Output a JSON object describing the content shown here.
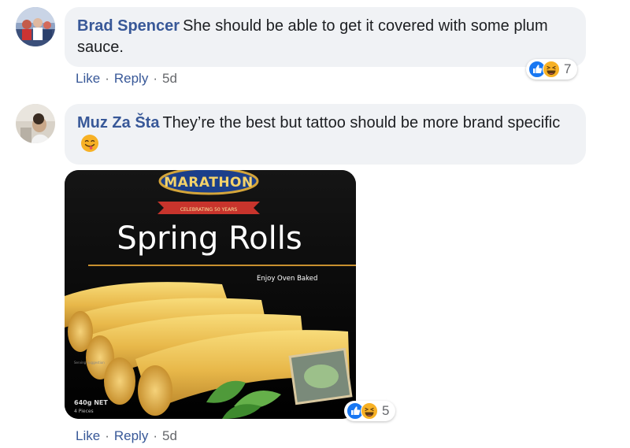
{
  "comments": [
    {
      "author": "Brad Spencer",
      "text": "She should be able to get it covered with some plum sauce.",
      "actions": {
        "like": "Like",
        "reply": "Reply",
        "separator": "·",
        "time": "5d"
      },
      "reactions": {
        "icons": [
          "like-icon",
          "haha-icon"
        ],
        "count": "7"
      }
    },
    {
      "author": "Muz Za Šta",
      "text": "They’re the best but tattoo should be more brand specific",
      "emoji": "tongue-out-emoji",
      "image": {
        "brand": "MARATHON",
        "banner": "CELEBRATING 50 YEARS",
        "title": "Spring Rolls",
        "tagline": "Enjoy Oven Baked",
        "weight": "640g NET",
        "pieces": "4 Pieces",
        "serving": "Serving Suggestion"
      },
      "actions": {
        "like": "Like",
        "reply": "Reply",
        "separator": "·",
        "time": "5d"
      },
      "reactions": {
        "icons": [
          "like-icon",
          "haha-icon"
        ],
        "count": "5"
      }
    }
  ],
  "colors": {
    "link": "#385898",
    "bubble": "#f0f2f5",
    "meta": "#65676b",
    "like_blue": "#1877f2",
    "haha_yellow": "#f7b125"
  }
}
